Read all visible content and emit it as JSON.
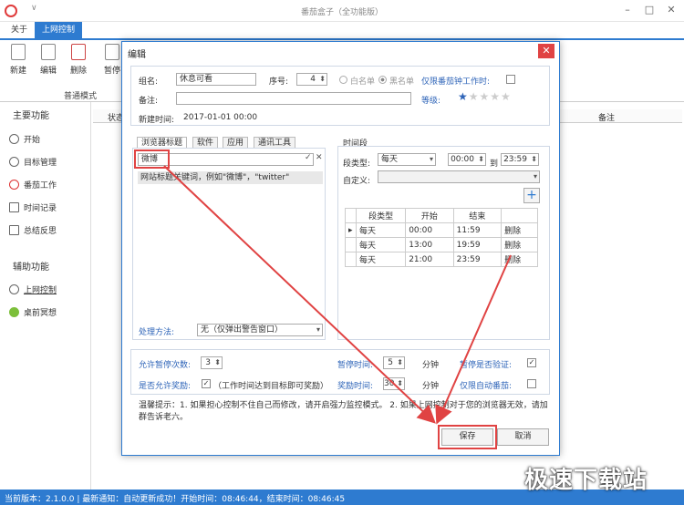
{
  "app": {
    "title": "番茄盒子（全功能版）",
    "menu_glyph": "∨"
  },
  "tabs": [
    {
      "label": "关于"
    },
    {
      "label": "上网控制"
    }
  ],
  "toolbar": {
    "buttons": [
      {
        "label": "新建"
      },
      {
        "label": "编辑"
      },
      {
        "label": "删除"
      },
      {
        "label": "暂停"
      }
    ],
    "group_label": "普通模式"
  },
  "sidebar": {
    "main_title": "主要功能",
    "main_items": [
      {
        "label": "开始"
      },
      {
        "label": "目标管理"
      },
      {
        "label": "番茄工作"
      },
      {
        "label": "时间记录"
      },
      {
        "label": "总结反思"
      }
    ],
    "aux_title": "辅助功能",
    "aux_items": [
      {
        "label": "上网控制"
      },
      {
        "label": "桌前冥想"
      }
    ]
  },
  "grid": {
    "col_status": "状态",
    "col_note": "备注"
  },
  "dialog": {
    "title": "编辑",
    "group_label": "组名:",
    "group_value": "休息可看",
    "seq_label": "序号:",
    "seq_value": "4",
    "whitelist": "白名单",
    "blacklist": "黑名单",
    "only_pomodoro": "仅限番茄钟工作时:",
    "note_label": "备注:",
    "note_value": "",
    "level_label": "等级:",
    "level_stars": 1,
    "level_max": 5,
    "created_label": "新建时间:",
    "created_value": "2017-01-01 00:00",
    "subtabs": [
      {
        "label": "浏览器标题"
      },
      {
        "label": "软件"
      },
      {
        "label": "应用"
      },
      {
        "label": "通讯工具"
      }
    ],
    "keyword_value": "微博",
    "keyword_hint": "网站标题关键词，例如\"微博\"，\"twitter\"",
    "method_label": "处理方法:",
    "method_value": "无（仅弹出警告窗口）",
    "time_section": "时间段",
    "seg_type_label": "段类型:",
    "seg_type_value": "每天",
    "seg_start": "00:00",
    "seg_to": "到",
    "seg_end": "23:59",
    "custom_label": "自定义:",
    "add_glyph": "+",
    "time_table": {
      "headers": [
        "段类型",
        "开始",
        "结束"
      ],
      "rows": [
        {
          "type": "每天",
          "start": "00:00",
          "end": "11:59",
          "action": "删除"
        },
        {
          "type": "每天",
          "start": "13:00",
          "end": "19:59",
          "action": "删除"
        },
        {
          "type": "每天",
          "start": "21:00",
          "end": "23:59",
          "action": "删除"
        }
      ]
    },
    "pause_times_label": "允许暂停次数:",
    "pause_times_value": "3",
    "pause_len_label": "暂停时间:",
    "pause_len_value": "5",
    "unit_min": "分钟",
    "verify_label": "暂停是否验证:",
    "reward_allow_label": "是否允许奖励:",
    "reward_allow_hint": "（工作时间达到目标即可奖励）",
    "reward_len_label": "奖励时间:",
    "reward_len_value": "30",
    "auto_pomodoro_label": "仅限自动番茄:",
    "tip": "温馨提示：1. 如果担心控制不住自己而修改，请开启强力监控模式。 2. 如果上网控制对于您的浏览器无效，请加群告诉老六。",
    "save": "保存",
    "cancel": "取消"
  },
  "status": {
    "text": "当前版本：2.1.0.0  |  最新通知：自动更新成功！开始时间：08:46:44，结束时间：08:46:45"
  },
  "watermark": "极速下载站",
  "colors": {
    "accent": "#2e7bd0",
    "highlight": "#e04343"
  }
}
